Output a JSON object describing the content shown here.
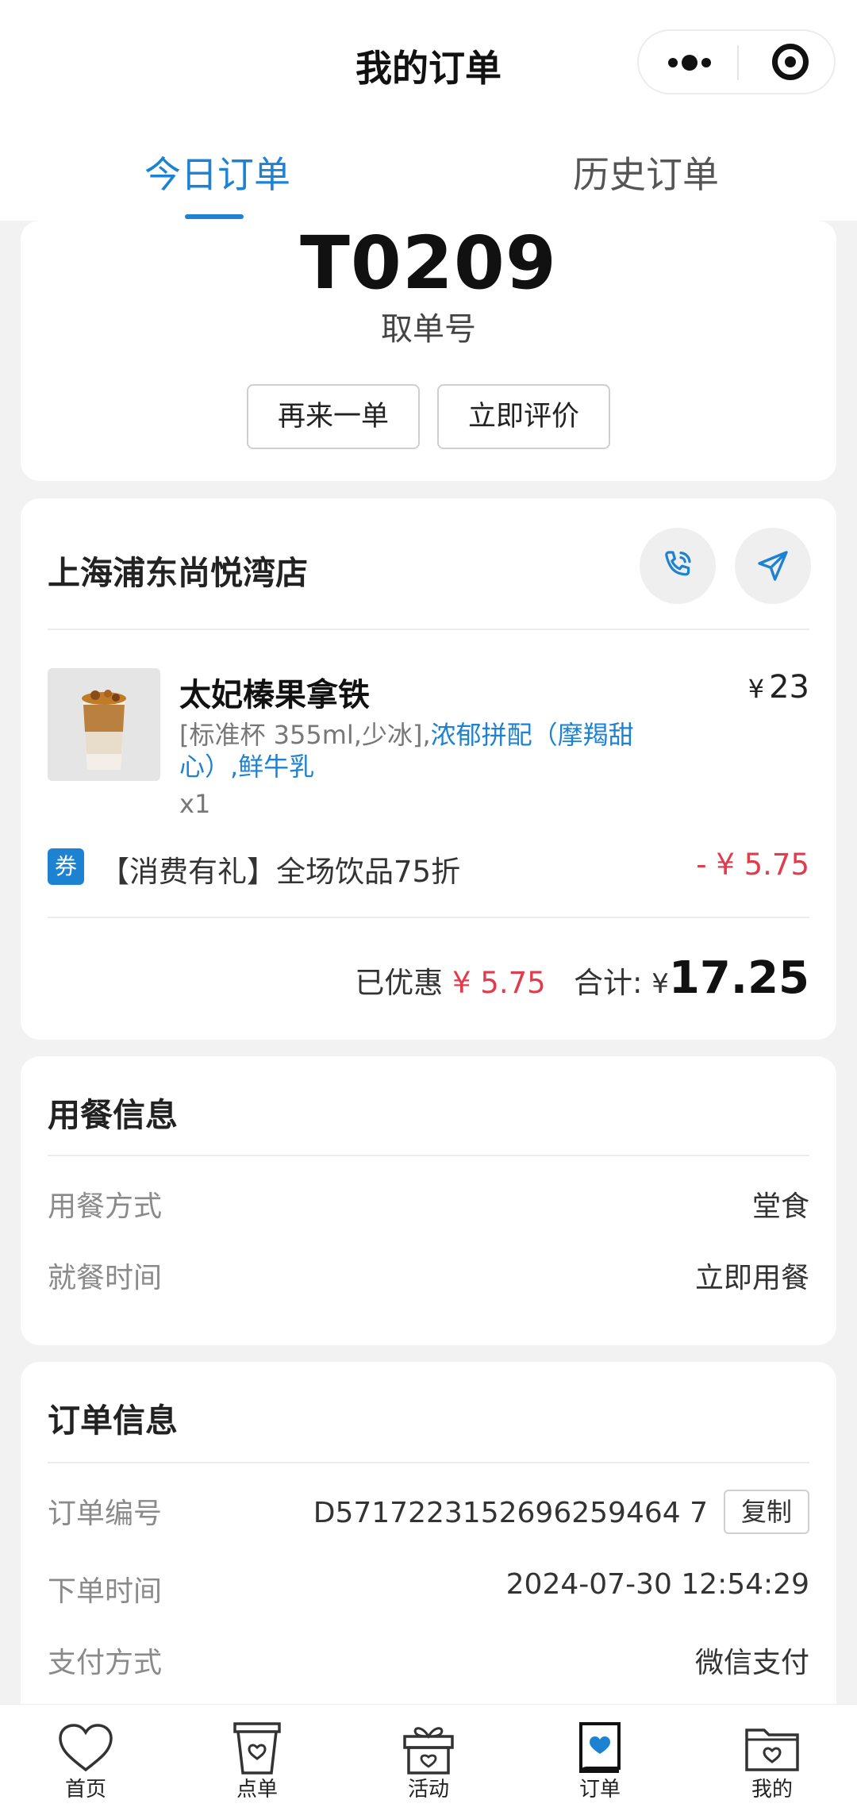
{
  "nav": {
    "title": "我的订单"
  },
  "tabs": {
    "today": "今日订单",
    "history": "历史订单"
  },
  "pickup": {
    "number": "T0209",
    "label": "取单号",
    "reorder": "再来一单",
    "review": "立即评价"
  },
  "store": {
    "name": "上海浦东尚悦湾店",
    "call_icon": "phone-icon",
    "nav_icon": "navigation-arrow-icon"
  },
  "product": {
    "name": "太妃榛果拿铁",
    "currency": "¥",
    "price": "23",
    "spec_plain": "[标准杯 355ml,少冰],",
    "spec_selected": "浓郁拼配（摩羯甜心）,鲜牛乳",
    "qty": "x1"
  },
  "coupon": {
    "badge": "券",
    "text": "【消费有礼】全场饮品75折",
    "amount": "- ¥ 5.75"
  },
  "summary": {
    "discount_label": "已优惠",
    "discount_value": "¥ 5.75",
    "total_label": "合计:",
    "currency": "¥",
    "total": "17.25"
  },
  "dining": {
    "title": "用餐信息",
    "rows": [
      {
        "label": "用餐方式",
        "value": "堂食"
      },
      {
        "label": "就餐时间",
        "value": "立即用餐"
      }
    ]
  },
  "order_info": {
    "title": "订单信息",
    "order_no_label": "订单编号",
    "order_no": "D5717223152696259464 7",
    "copy": "复制",
    "time_label": "下单时间",
    "time": "2024-07-30 12:54:29",
    "pay_label": "支付方式",
    "pay": "微信支付"
  },
  "tabbar": [
    {
      "label": "首页",
      "icon": "heart-icon"
    },
    {
      "label": "点单",
      "icon": "cup-icon"
    },
    {
      "label": "活动",
      "icon": "gift-icon"
    },
    {
      "label": "订单",
      "icon": "order-icon"
    },
    {
      "label": "我的",
      "icon": "folder-heart-icon"
    }
  ],
  "colors": {
    "accent": "#1e82d2",
    "discount": "#e03c4c"
  }
}
